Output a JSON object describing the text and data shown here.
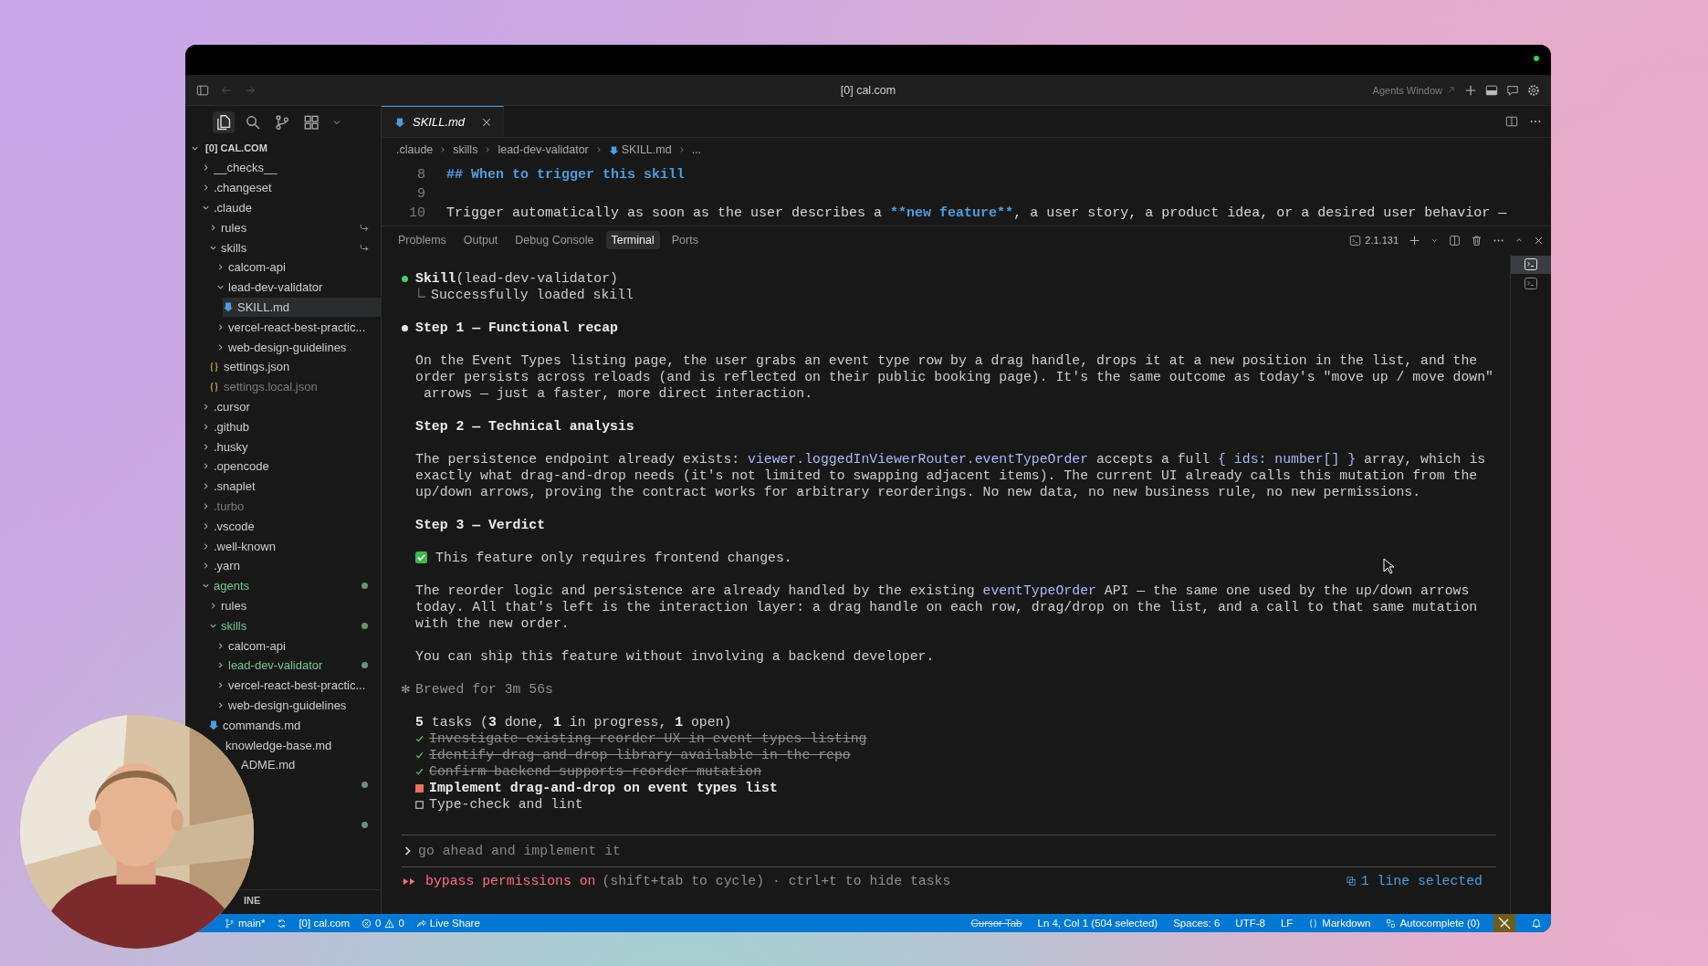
{
  "window": {
    "title": "[0] cal.com",
    "agents_window": "Agents Window"
  },
  "sidebar": {
    "root": "[0] CAL.COM",
    "tree": [
      {
        "label": "__checks__",
        "kind": "folder",
        "expanded": false,
        "selected": false,
        "modified": false,
        "ignored": false,
        "linked": false
      },
      {
        "label": ".changeset",
        "kind": "folder",
        "expanded": false,
        "selected": false,
        "modified": false,
        "ignored": false,
        "linked": false
      },
      {
        "label": ".claude",
        "kind": "folder",
        "expanded": true,
        "selected": false,
        "modified": false,
        "ignored": false,
        "linked": false,
        "children": [
          {
            "label": "rules",
            "kind": "folder",
            "expanded": false,
            "selected": false,
            "modified": false,
            "ignored": false,
            "linked": true
          },
          {
            "label": "skills",
            "kind": "folder",
            "expanded": true,
            "selected": false,
            "modified": false,
            "ignored": false,
            "linked": true,
            "children": [
              {
                "label": "calcom-api",
                "kind": "folder",
                "expanded": false,
                "selected": false,
                "modified": false,
                "ignored": false,
                "linked": false
              },
              {
                "label": "lead-dev-validator",
                "kind": "folder",
                "expanded": true,
                "selected": false,
                "modified": false,
                "ignored": false,
                "linked": false,
                "children": [
                  {
                    "label": "SKILL.md",
                    "kind": "md",
                    "selected": true,
                    "modified": false,
                    "ignored": false,
                    "linked": false
                  }
                ]
              },
              {
                "label": "vercel-react-best-practic...",
                "kind": "folder",
                "expanded": false,
                "selected": false,
                "modified": false,
                "ignored": false,
                "linked": false
              },
              {
                "label": "web-design-guidelines",
                "kind": "folder",
                "expanded": false,
                "selected": false,
                "modified": false,
                "ignored": false,
                "linked": false
              }
            ]
          },
          {
            "label": "settings.json",
            "kind": "json",
            "selected": false,
            "modified": false,
            "ignored": false,
            "linked": false
          },
          {
            "label": "settings.local.json",
            "kind": "json",
            "selected": false,
            "modified": false,
            "ignored": true,
            "linked": false
          }
        ]
      },
      {
        "label": ".cursor",
        "kind": "folder",
        "expanded": false,
        "selected": false,
        "modified": false,
        "ignored": false,
        "linked": false
      },
      {
        "label": ".github",
        "kind": "folder",
        "expanded": false,
        "selected": false,
        "modified": false,
        "ignored": false,
        "linked": false
      },
      {
        "label": ".husky",
        "kind": "folder",
        "expanded": false,
        "selected": false,
        "modified": false,
        "ignored": false,
        "linked": false
      },
      {
        "label": ".opencode",
        "kind": "folder",
        "expanded": false,
        "selected": false,
        "modified": false,
        "ignored": false,
        "linked": false
      },
      {
        "label": ".snaplet",
        "kind": "folder",
        "expanded": false,
        "selected": false,
        "modified": false,
        "ignored": false,
        "linked": false
      },
      {
        "label": ".turbo",
        "kind": "folder",
        "expanded": false,
        "selected": false,
        "modified": false,
        "ignored": true,
        "linked": false
      },
      {
        "label": ".vscode",
        "kind": "folder",
        "expanded": false,
        "selected": false,
        "modified": false,
        "ignored": false,
        "linked": false
      },
      {
        "label": ".well-known",
        "kind": "folder",
        "expanded": false,
        "selected": false,
        "modified": false,
        "ignored": false,
        "linked": false
      },
      {
        "label": ".yarn",
        "kind": "folder",
        "expanded": false,
        "selected": false,
        "modified": false,
        "ignored": false,
        "linked": false
      },
      {
        "label": "agents",
        "kind": "folder",
        "expanded": true,
        "selected": false,
        "modified": true,
        "ignored": false,
        "linked": false,
        "children": [
          {
            "label": "rules",
            "kind": "folder",
            "expanded": false,
            "selected": false,
            "modified": false,
            "ignored": false,
            "linked": false
          },
          {
            "label": "skills",
            "kind": "folder",
            "expanded": true,
            "selected": false,
            "modified": true,
            "ignored": false,
            "linked": false,
            "children": [
              {
                "label": "calcom-api",
                "kind": "folder",
                "expanded": false,
                "selected": false,
                "modified": false,
                "ignored": false,
                "linked": false
              },
              {
                "label": "lead-dev-validator",
                "kind": "folder",
                "expanded": false,
                "selected": false,
                "modified": true,
                "ignored": false,
                "linked": false
              },
              {
                "label": "vercel-react-best-practic...",
                "kind": "folder",
                "expanded": false,
                "selected": false,
                "modified": false,
                "ignored": false,
                "linked": false
              },
              {
                "label": "web-design-guidelines",
                "kind": "folder",
                "expanded": false,
                "selected": false,
                "modified": false,
                "ignored": false,
                "linked": false
              }
            ]
          },
          {
            "label": "commands.md",
            "kind": "md",
            "selected": false,
            "modified": false,
            "ignored": false,
            "linked": false
          },
          {
            "label": "knowledge-base.md",
            "kind": "file",
            "selected": false,
            "modified": false,
            "ignored": false,
            "linked": false
          },
          {
            "label": "ADME.md",
            "kind": "clipped",
            "selected": false,
            "modified": false,
            "ignored": false,
            "linked": false
          }
        ]
      },
      {
        "kind": "modified-marker"
      },
      {
        "kind": "blank"
      },
      {
        "kind": "modified-marker"
      }
    ],
    "outline": "INE"
  },
  "editor": {
    "tab": {
      "label": "SKILL.md",
      "selected": true
    },
    "breadcrumb": [
      {
        "label": ".claude",
        "kind": "folder"
      },
      {
        "label": "skills",
        "kind": "folder"
      },
      {
        "label": "lead-dev-validator",
        "kind": "folder"
      },
      {
        "label": "SKILL.md",
        "kind": "md"
      },
      {
        "label": "...",
        "kind": "more"
      }
    ],
    "lines": [
      {
        "number": "8",
        "segments": [
          {
            "text": "## When to trigger this skill",
            "kind": "heading"
          }
        ]
      },
      {
        "number": "9"
      },
      {
        "number": "10",
        "segments": [
          {
            "text": "Trigger automatically as soon as the user describes a ",
            "kind": "plain"
          },
          {
            "text": "**new feature**",
            "kind": "bold"
          },
          {
            "text": ", a user story, a product idea, or a desired user behavior —",
            "kind": "plain"
          }
        ]
      }
    ]
  },
  "panel": {
    "tabs": [
      {
        "label": "Problems",
        "selected": false
      },
      {
        "label": "Output",
        "selected": false
      },
      {
        "label": "Debug Console",
        "selected": false
      },
      {
        "label": "Terminal",
        "selected": true
      },
      {
        "label": "Ports",
        "selected": false
      }
    ],
    "version": "2.1.131"
  },
  "terminal": {
    "blocks": [
      {
        "kind": "tool",
        "name": "Skill",
        "args": "(lead-dev-validator)"
      },
      {
        "kind": "result",
        "text": "Successfully loaded skill"
      },
      {
        "kind": "message-heading",
        "text": "Step 1 — Functional recap"
      },
      {
        "kind": "para",
        "segments": [
          {
            "text": "On the Event Types listing page, the user grabs an event type row by a drag handle, drops it at a new position in the list, and the\norder persists across reloads (and is reflected on their public booking page). It's the same outcome as today's \"move up / move down\"\n arrows — just a faster, more direct interaction.",
            "kind": "plain"
          }
        ]
      },
      {
        "kind": "heading",
        "text": "Step 2 — Technical analysis"
      },
      {
        "kind": "para",
        "segments": [
          {
            "text": "The persistence endpoint already exists: ",
            "kind": "plain"
          },
          {
            "text": "viewer.loggedInViewerRouter.eventTypeOrder",
            "kind": "code"
          },
          {
            "text": " accepts a full ",
            "kind": "plain"
          },
          {
            "text": "{ ids: number[] }",
            "kind": "code"
          },
          {
            "text": " array, which is\nexactly what drag-and-drop needs (it's not limited to swapping adjacent items). The current UI already calls this mutation from the\nup/down arrows, proving the contract works for arbitrary reorderings. No new data, no new business rule, no new permissions.",
            "kind": "plain"
          }
        ]
      },
      {
        "kind": "heading",
        "text": "Step 3 — Verdict"
      },
      {
        "kind": "check",
        "text": "This feature only requires frontend changes."
      },
      {
        "kind": "para",
        "segments": [
          {
            "text": "The reorder logic and persistence are already handled by the existing ",
            "kind": "plain"
          },
          {
            "text": "eventTypeOrder",
            "kind": "code"
          },
          {
            "text": " API — the same one used by the up/down arrows\ntoday. All that's left is the interaction layer: a drag handle on each row, drag/drop on the list, and a call to that same mutation\nwith the new order.",
            "kind": "plain"
          }
        ]
      },
      {
        "kind": "para",
        "segments": [
          {
            "text": "You can ship this feature without involving a backend developer.",
            "kind": "plain"
          }
        ]
      },
      {
        "kind": "status",
        "icon": "✻",
        "text": "Brewed for 3m 56s"
      },
      {
        "kind": "tasks",
        "summary": "**5** tasks (**3** done, **1** in progress, **1** open)",
        "items": [
          {
            "text": "Investigate existing reorder UX in event types listing",
            "kind": "done"
          },
          {
            "text": "Identify drag-and-drop library available in the repo",
            "kind": "done"
          },
          {
            "text": "Confirm backend supports reorder mutation",
            "kind": "done"
          },
          {
            "text": "Implement drag-and-drop on event types list",
            "kind": "in_progress"
          },
          {
            "text": "Type-check and lint",
            "kind": "open"
          }
        ]
      }
    ],
    "prompt": {
      "placeholder": "go ahead and implement it"
    },
    "mode": {
      "label": "bypass permissions on",
      "hint": "(shift+tab to cycle) · ctrl+t to hide tasks"
    },
    "selection": "1 line selected",
    "sessions": [
      {
        "selected": true
      },
      {
        "selected": false
      }
    ]
  },
  "status_bar": {
    "branch": "main*",
    "workspace": "[0] cal.com",
    "errors": "0",
    "warnings": "0",
    "live_share": "Live Share",
    "right": [
      {
        "text": "Cursor Tab",
        "kind": "struck"
      },
      {
        "text": "Ln 4, Col 1 (504 selected)",
        "kind": "plain"
      },
      {
        "text": "Spaces: 6",
        "kind": "plain"
      },
      {
        "text": "UTF-8",
        "kind": "plain"
      },
      {
        "text": "LF",
        "kind": "plain"
      },
      {
        "text": "Markdown",
        "kind": "language"
      },
      {
        "text": "Autocomplete (0)",
        "kind": "autocomplete"
      }
    ]
  }
}
